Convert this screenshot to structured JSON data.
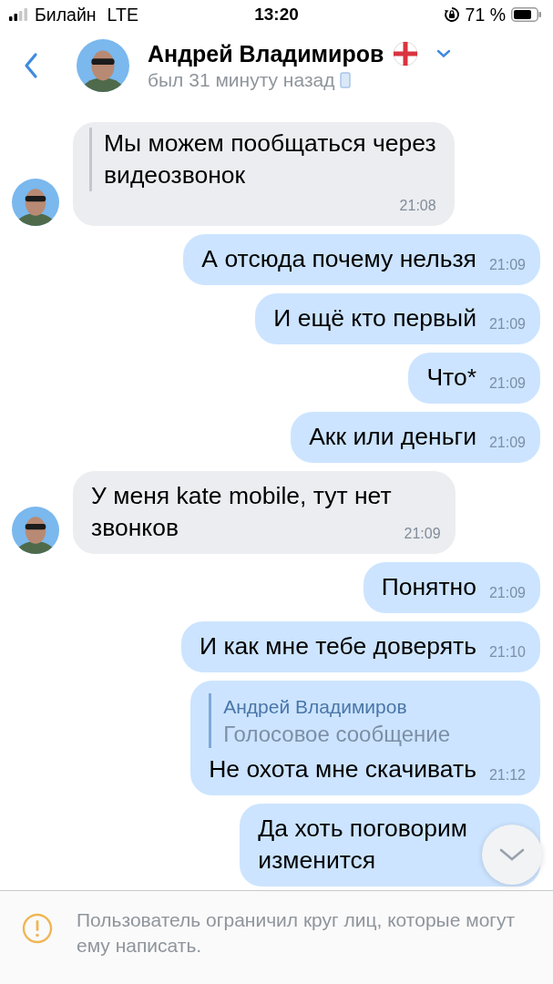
{
  "status_bar": {
    "carrier": "Билайн",
    "network": "LTE",
    "time": "13:20",
    "battery": "71 %"
  },
  "header": {
    "name": "Андрей Владимиров",
    "status": "был 31 минуту назад"
  },
  "messages": [
    {
      "outgoing": false,
      "kind": "quote",
      "quote_lines": [
        "Мы можем пообщаться через",
        "видеозвонок"
      ],
      "time": "21:08"
    },
    {
      "outgoing": true,
      "kind": "text",
      "lines": [
        "А отсюда почему нельзя"
      ],
      "time": "21:09"
    },
    {
      "outgoing": true,
      "kind": "text",
      "lines": [
        "И ещё кто первый"
      ],
      "time": "21:09"
    },
    {
      "outgoing": true,
      "kind": "text",
      "lines": [
        "Что*"
      ],
      "time": "21:09"
    },
    {
      "outgoing": true,
      "kind": "text",
      "lines": [
        "Акк или деньги"
      ],
      "time": "21:09"
    },
    {
      "outgoing": false,
      "kind": "text",
      "lines": [
        "У меня kate mobile, тут нет",
        "звонков"
      ],
      "time": "21:09"
    },
    {
      "outgoing": true,
      "kind": "text",
      "lines": [
        "Понятно"
      ],
      "time": "21:09"
    },
    {
      "outgoing": true,
      "kind": "text",
      "lines": [
        "И как мне тебе доверять"
      ],
      "time": "21:10"
    },
    {
      "outgoing": true,
      "kind": "reply",
      "reply_author": "Андрей Владимиров",
      "reply_text": "Голосовое сообщение",
      "lines": [
        "Не охота мне скачивать"
      ],
      "time": "21:12"
    },
    {
      "outgoing": true,
      "kind": "text",
      "lines": [
        "Да хоть поговорим",
        "изменится"
      ]
    }
  ],
  "notice": "Пользователь ограничил круг лиц, которые могут ему написать."
}
